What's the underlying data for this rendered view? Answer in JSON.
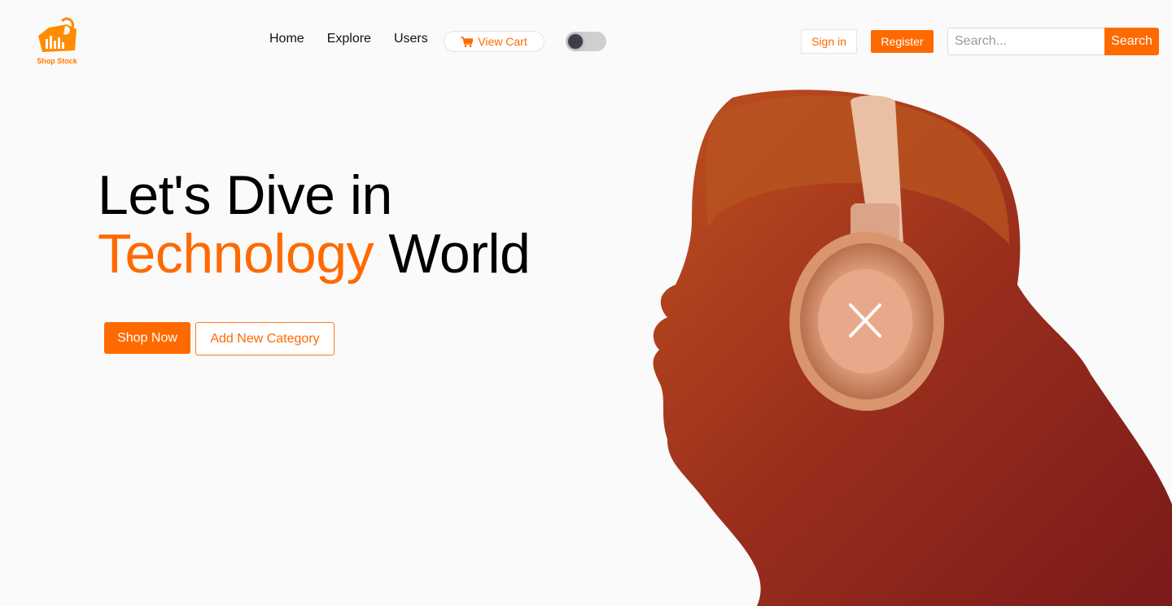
{
  "brand": {
    "name": "Shop Stock",
    "accent_color": "#ff6a00"
  },
  "nav": {
    "items": [
      "Home",
      "Explore",
      "Users"
    ],
    "cart_label": "View Cart",
    "cart_icon": "shopping-cart-icon",
    "theme_toggle": {
      "state": "off"
    }
  },
  "auth": {
    "signin_label": "Sign in",
    "register_label": "Register"
  },
  "search": {
    "placeholder": "Search...",
    "button_label": "Search"
  },
  "hero": {
    "line1": "Let's Dive in",
    "accent_word": "Technology",
    "line2_rest": " World",
    "primary_button": "Shop Now",
    "secondary_button": "Add New Category",
    "image": "man-wearing-headphones-photo"
  }
}
